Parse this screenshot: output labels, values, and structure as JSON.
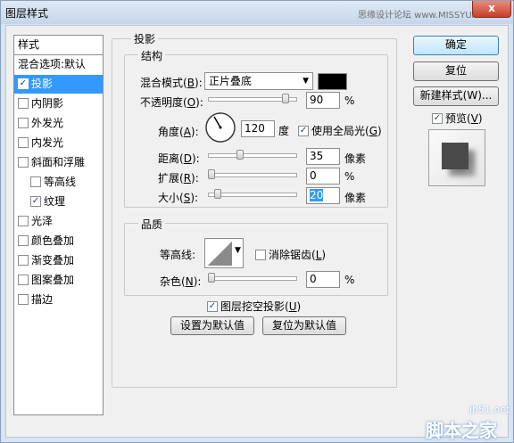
{
  "window": {
    "title": "图层样式",
    "watermark": "思缘设计论坛 www.MISSYUAN.COM",
    "close_glyph": "x"
  },
  "styles_panel": {
    "header": "样式",
    "items": [
      {
        "label": "混合选项:默认",
        "checkbox": false,
        "checked": false,
        "selected": false,
        "indent": false
      },
      {
        "label": "投影",
        "checkbox": true,
        "checked": true,
        "selected": true,
        "indent": false
      },
      {
        "label": "内阴影",
        "checkbox": true,
        "checked": false,
        "selected": false,
        "indent": false
      },
      {
        "label": "外发光",
        "checkbox": true,
        "checked": false,
        "selected": false,
        "indent": false
      },
      {
        "label": "内发光",
        "checkbox": true,
        "checked": false,
        "selected": false,
        "indent": false
      },
      {
        "label": "斜面和浮雕",
        "checkbox": true,
        "checked": false,
        "selected": false,
        "indent": false
      },
      {
        "label": "等高线",
        "checkbox": true,
        "checked": false,
        "selected": false,
        "indent": true
      },
      {
        "label": "纹理",
        "checkbox": true,
        "checked": true,
        "selected": false,
        "indent": true
      },
      {
        "label": "光泽",
        "checkbox": true,
        "checked": false,
        "selected": false,
        "indent": false
      },
      {
        "label": "颜色叠加",
        "checkbox": true,
        "checked": false,
        "selected": false,
        "indent": false
      },
      {
        "label": "渐变叠加",
        "checkbox": true,
        "checked": false,
        "selected": false,
        "indent": false
      },
      {
        "label": "图案叠加",
        "checkbox": true,
        "checked": false,
        "selected": false,
        "indent": false
      },
      {
        "label": "描边",
        "checkbox": true,
        "checked": false,
        "selected": false,
        "indent": false
      }
    ]
  },
  "drop_shadow": {
    "section_title": "投影",
    "structure": {
      "group_title": "结构",
      "blend_mode": {
        "label": "混合模式",
        "key": "B",
        "value": "正片叠底",
        "color": "#000000"
      },
      "opacity": {
        "label": "不透明度",
        "key": "O",
        "value": "90",
        "unit": "%",
        "level": 0.9
      },
      "angle": {
        "label": "角度",
        "key": "A",
        "value": "120",
        "unit": "度",
        "global_light_label": "使用全局光",
        "global_light_key": "G",
        "global_light_checked": true
      },
      "distance": {
        "label": "距离",
        "key": "D",
        "value": "35",
        "unit": "像素",
        "level": 0.35
      },
      "spread": {
        "label": "扩展",
        "key": "R",
        "value": "0",
        "unit": "%",
        "level": 0
      },
      "size": {
        "label": "大小",
        "key": "S",
        "value": "20",
        "unit": "像素",
        "level": 0.08
      }
    },
    "quality": {
      "group_title": "品质",
      "contour_label": "等高线:",
      "anti_alias_label": "消除锯齿",
      "anti_alias_key": "L",
      "anti_alias_checked": false,
      "noise": {
        "label": "杂色",
        "key": "N",
        "value": "0",
        "unit": "%",
        "level": 0
      }
    },
    "knockout": {
      "label": "图层挖空投影",
      "key": "U",
      "checked": true
    },
    "set_default_button": "设置为默认值",
    "reset_default_button": "复位为默认值"
  },
  "buttons": {
    "ok": "确定",
    "reset": "复位",
    "new_style": "新建样式(W)...",
    "preview_label": "预览",
    "preview_key": "V",
    "preview_checked": true
  },
  "footer_watermark": {
    "site": "jb51.net",
    "name": "脚本之家"
  }
}
